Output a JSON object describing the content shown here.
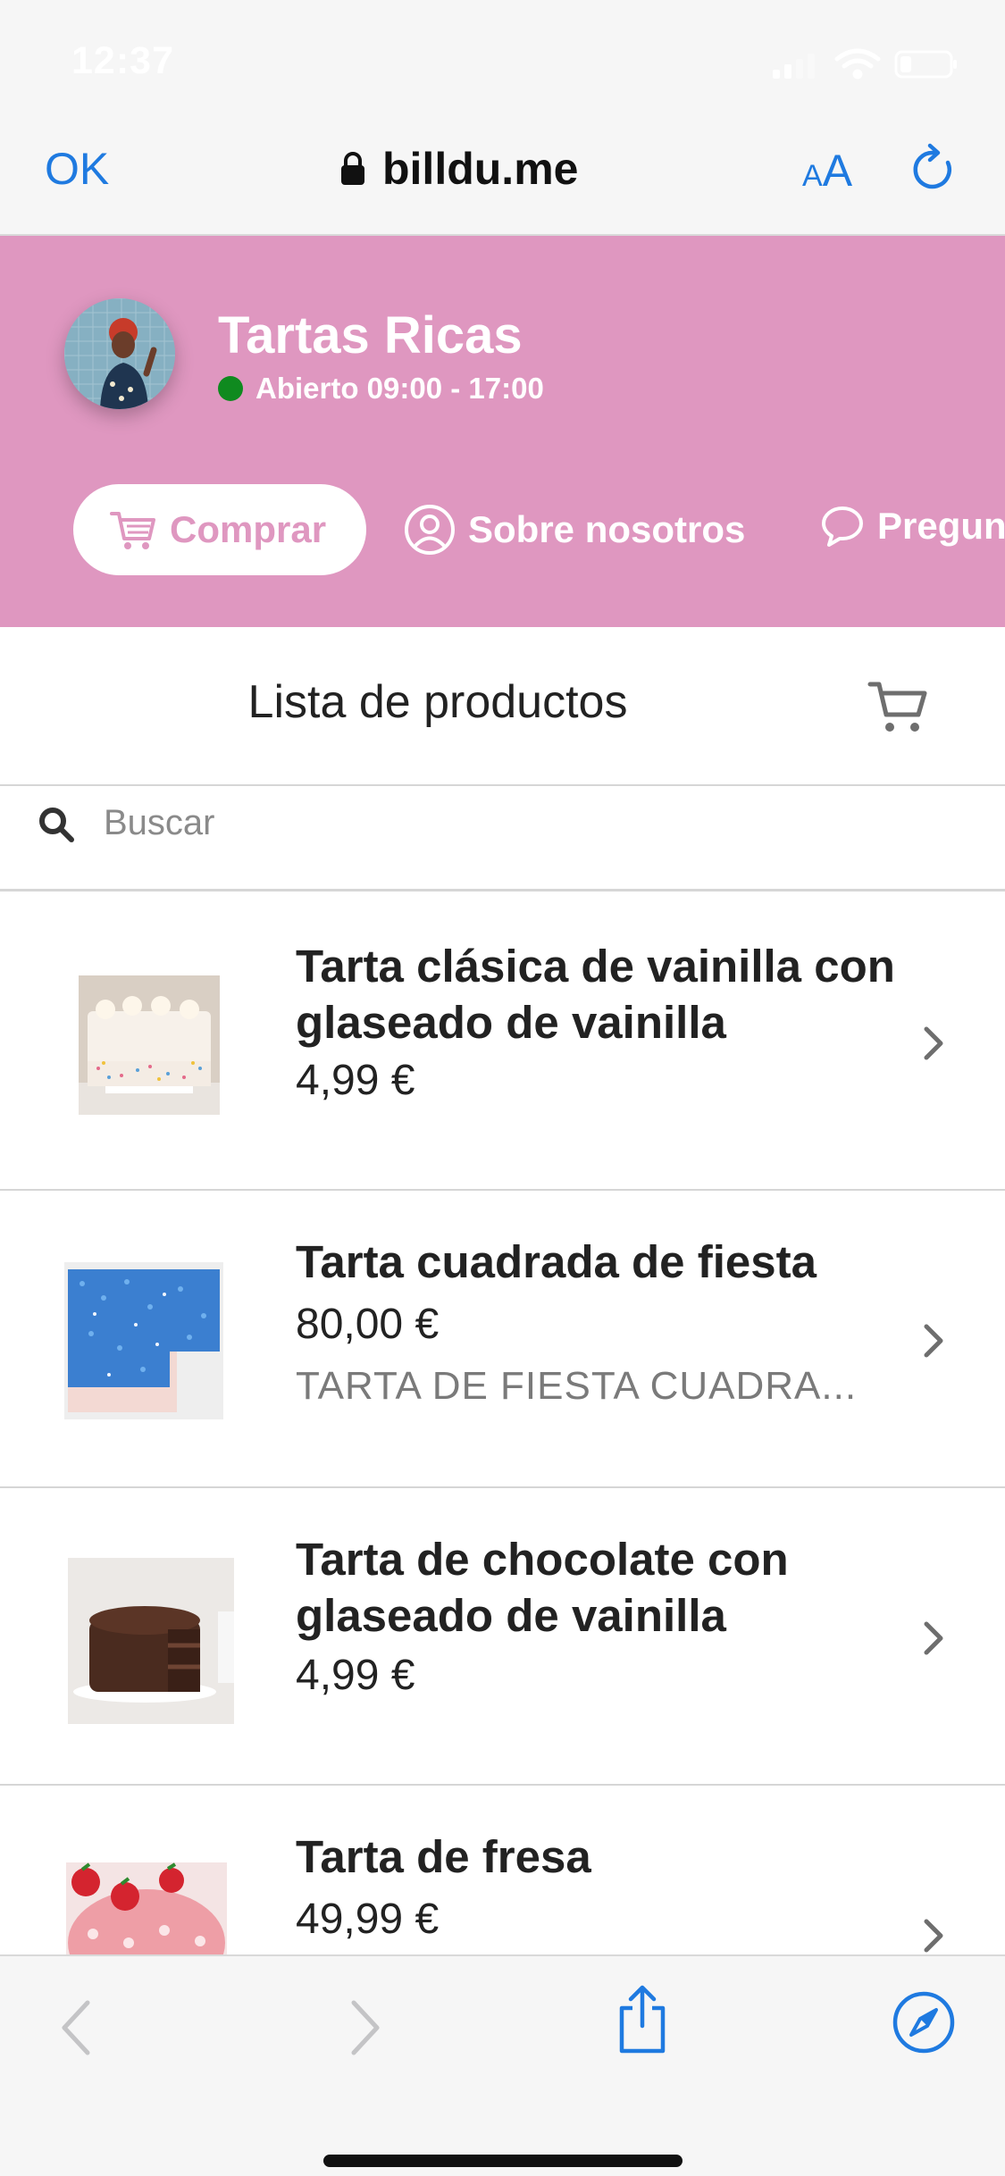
{
  "status_bar": {
    "time": "12:37"
  },
  "browser": {
    "done_label": "OK",
    "url": "billdu.me",
    "text_size_small": "A",
    "text_size_large": "A"
  },
  "shop": {
    "name": "Tartas Ricas",
    "status": "Abierto 09:00 - 17:00",
    "status_color": "#0f8a1f",
    "header_color": "#df97c0",
    "nav": [
      {
        "label": "Comprar",
        "icon": "cart-icon"
      },
      {
        "label": "Sobre nosotros",
        "icon": "user-circle-icon"
      },
      {
        "label": "Pregun",
        "icon": "chat-bubble-icon"
      }
    ]
  },
  "list": {
    "title": "Lista de productos",
    "search_placeholder": "Buscar"
  },
  "products": [
    {
      "name": "Tarta clásica de vainilla con glaseado de vainilla",
      "price": "4,99 €",
      "description": ""
    },
    {
      "name": "Tarta cuadrada de fiesta",
      "price": "80,00 €",
      "description": "TARTA DE FIESTA CUADRA..."
    },
    {
      "name": "Tarta de chocolate con glaseado de vainilla",
      "price": "4,99 €",
      "description": ""
    },
    {
      "name": "Tarta de fresa",
      "price": "49,99 €",
      "description": ""
    }
  ],
  "accent_color": "#1f7ae0"
}
